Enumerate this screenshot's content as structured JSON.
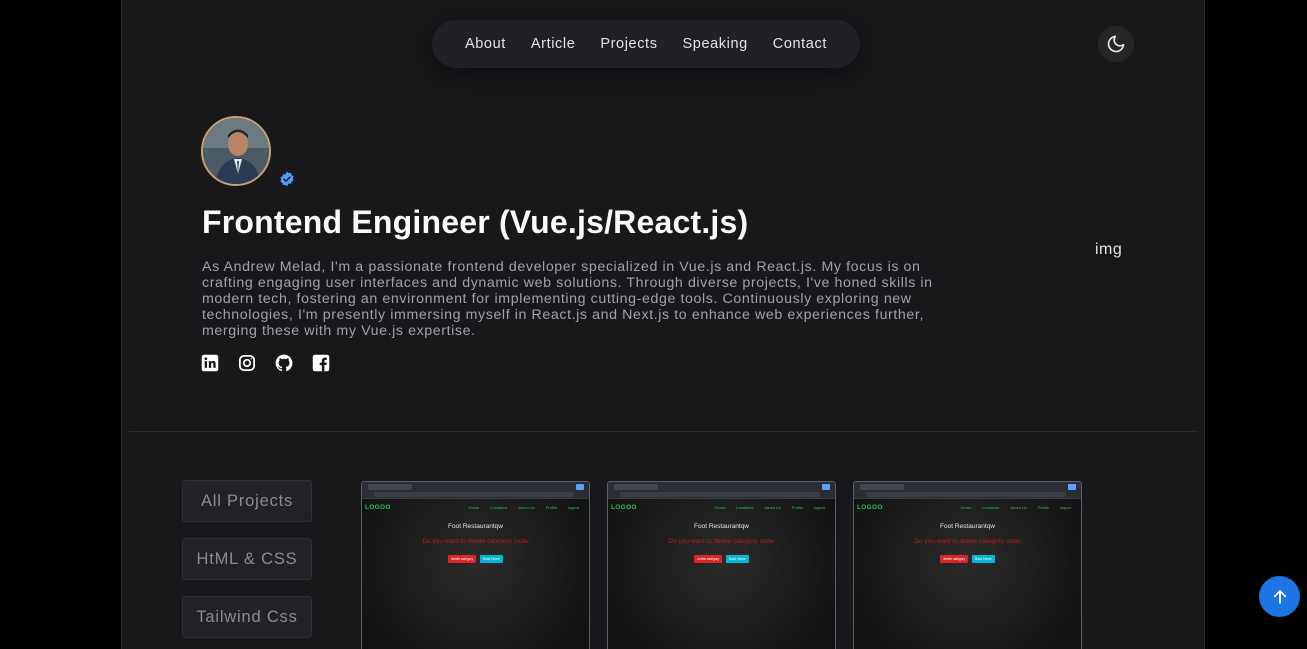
{
  "nav": {
    "items": [
      {
        "label": "About"
      },
      {
        "label": "Article"
      },
      {
        "label": "Projects"
      },
      {
        "label": "Speaking"
      },
      {
        "label": "Contact"
      }
    ],
    "theme_icon": "moon-icon"
  },
  "hero": {
    "headline": "Frontend Engineer (Vue.js/React.js)",
    "bio": "As Andrew Melad, I'm a passionate frontend developer specialized in Vue.js and React.js. My focus is on crafting engaging user interfaces and dynamic web solutions. Through diverse projects, I've honed skills in modern tech, fostering an environment for implementing cutting-edge tools. Continuously exploring new technologies, I'm presently immersing myself in React.js and Next.js to enhance web experiences further, merging these with my Vue.js expertise.",
    "image_alt": "img",
    "socials": [
      "linkedin-icon",
      "instagram-icon",
      "github-icon",
      "facebook-icon"
    ],
    "accent": "#4a9eff"
  },
  "projects": {
    "filters": [
      {
        "label": "All Projects"
      },
      {
        "label": "HtML & CSS"
      },
      {
        "label": "Tailwind Css"
      }
    ],
    "cards": [
      {
        "logo": "LOGOO",
        "nav": [
          "Home",
          "Locations",
          "About Us",
          "Profile",
          "logout"
        ],
        "title": "Foot Restaurantqw",
        "question": "Do you want to delete category sxdw",
        "btn_delete": "delete category",
        "btn_back": "Back Home"
      },
      {
        "logo": "LOGOO",
        "nav": [
          "Home",
          "Locations",
          "About Us",
          "Profile",
          "logout"
        ],
        "title": "Foot Restaurantqw",
        "question": "Do you want to delete category sxdw",
        "btn_delete": "delete category",
        "btn_back": "Back Home"
      },
      {
        "logo": "LOGOO",
        "nav": [
          "Home",
          "Locations",
          "About Us",
          "Profile",
          "logout"
        ],
        "title": "Foot Restaurantqw",
        "question": "Do you want to delete category sxdw",
        "btn_delete": "delete category",
        "btn_back": "Back Home"
      }
    ]
  },
  "scroll_top_icon": "arrow-up-icon",
  "colors": {
    "background": "#18181b",
    "outer": "#000000",
    "primary_button": "#1d74e3"
  }
}
